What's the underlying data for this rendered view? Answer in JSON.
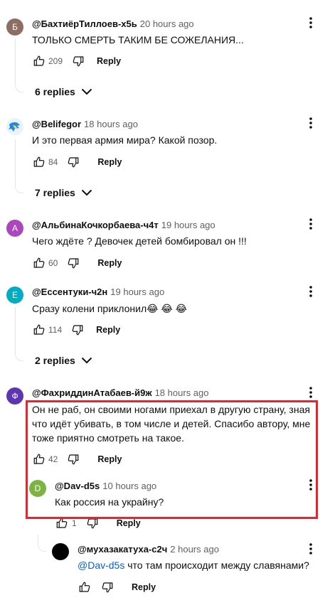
{
  "comments": [
    {
      "avatar_letter": "Б",
      "avatar_color": "#8d6e63",
      "author": "@БахтиёрТиллоев-х5ь",
      "time": "20 hours ago",
      "text": "ТОЛЬКО СМЕРТЬ ТАКИМ БЕ СОЖЕЛАНИЯ...",
      "likes": "209",
      "reply_label": "Reply",
      "replies_label": "6 replies"
    },
    {
      "avatar_letter": "",
      "avatar_color": "#1e88e5",
      "author": "@Belifegor",
      "time": "18 hours ago",
      "text": "И это первая армия мира? Какой позор.",
      "likes": "84",
      "reply_label": "Reply",
      "replies_label": "7 replies"
    },
    {
      "avatar_letter": "А",
      "avatar_color": "#ab47bc",
      "author": "@АльбинаКочкорбаева-ч4т",
      "time": "19 hours ago",
      "text": "Чего ждёте ? Девочек детей бомбировал он !!!",
      "likes": "60",
      "reply_label": "Reply"
    },
    {
      "avatar_letter": "Е",
      "avatar_color": "#00acc1",
      "author": "@Ессентуки-ч2н",
      "time": "19 hours ago",
      "text": "Сразу колени приклонил😂 😂 😂",
      "likes": "114",
      "reply_label": "Reply",
      "replies_label": "2 replies"
    },
    {
      "avatar_letter": "Ф",
      "avatar_color": "#5e35b1",
      "author": "@ФахриддинАтабаев-й9ж",
      "time": "18 hours ago",
      "text_lines": [
        "Он не раб, он своими ногами приехал в другую страну, зная",
        "что идёт убивать, в том числе и детей. Спасибо автору, мне",
        "тоже приятно смотреть на такое."
      ],
      "likes": "42",
      "reply_label": "Reply"
    }
  ],
  "replies": [
    {
      "avatar_letter": "D",
      "avatar_color": "#7cb342",
      "author": "@Dav-d5s",
      "time": "10 hours ago",
      "text": "Как россия на украйну?",
      "likes": "1",
      "reply_label": "Reply"
    },
    {
      "avatar_letter": "",
      "avatar_color": "#000000",
      "author": "@мухазакатуха-с2ч",
      "time": "2 hours ago",
      "mention": "@Dav-d5s",
      "text": " что там происходит между славянами?",
      "reply_label": "Reply"
    }
  ]
}
